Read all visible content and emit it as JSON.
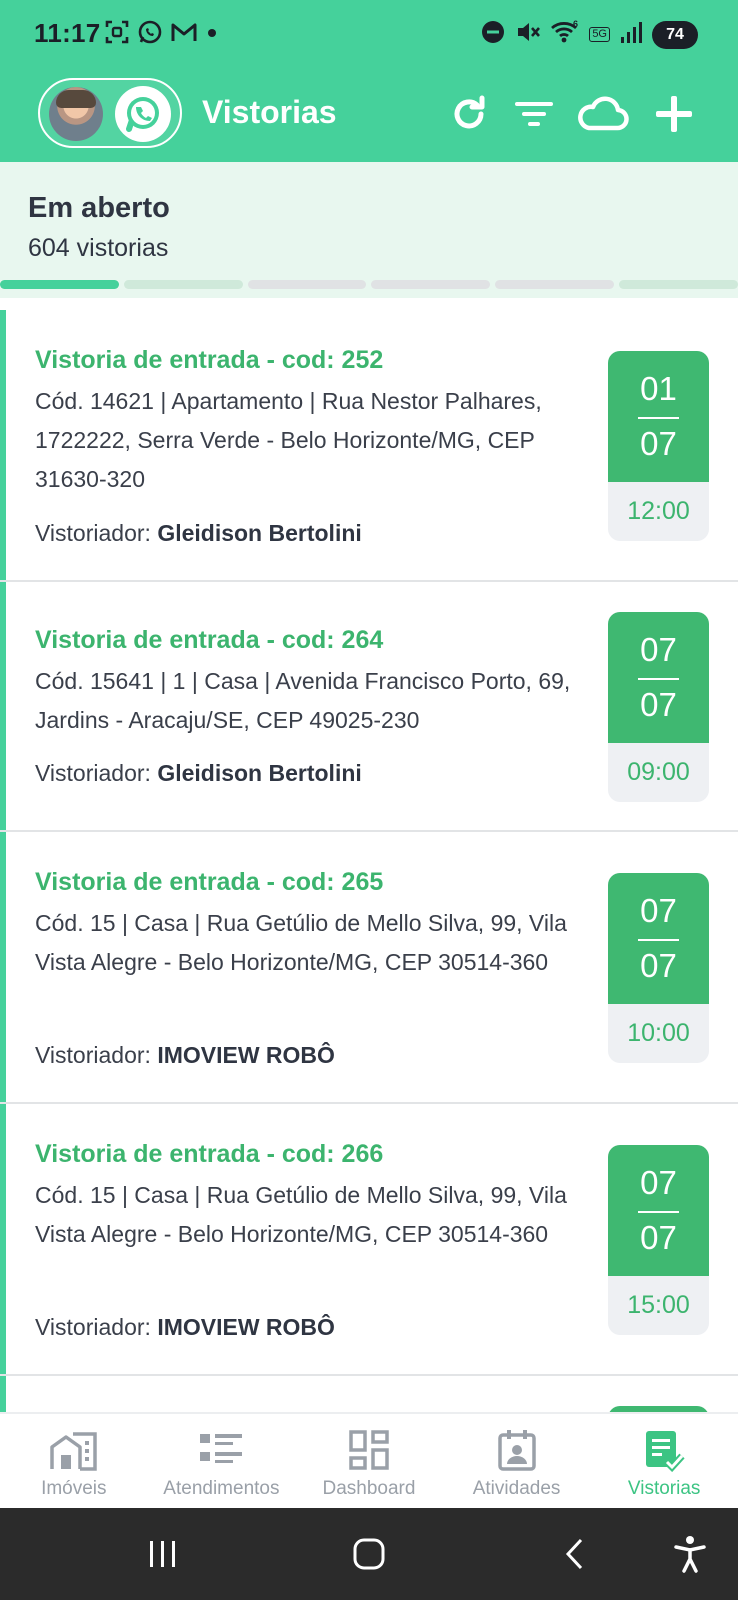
{
  "status_bar": {
    "time": "11:17",
    "battery": "74",
    "network": "5G"
  },
  "app_bar": {
    "title": "Vistorias",
    "actions": [
      "refresh-icon",
      "filter-icon",
      "cloud-icon",
      "add-icon"
    ]
  },
  "section": {
    "title": "Em aberto",
    "count": "604 vistorias",
    "tabs_total": 6,
    "active_tab": 0
  },
  "inspections": [
    {
      "title": "Vistoria de entrada - cod: 252",
      "address": "Cód. 14621 | Apartamento | Rua Nestor Palhares, 1722222, Serra Verde - Belo Horizonte/MG, CEP 31630-320",
      "inspector_label": "Vistoriador: ",
      "inspector": "Gleidison Bertolini",
      "day": "01",
      "month": "07",
      "time": "12:00"
    },
    {
      "title": "Vistoria de entrada - cod: 264",
      "address": "Cód. 15641 | 1 | Casa | Avenida Francisco Porto, 69, Jardins - Aracaju/SE, CEP 49025-230",
      "inspector_label": "Vistoriador: ",
      "inspector": "Gleidison Bertolini",
      "day": "07",
      "month": "07",
      "time": "09:00"
    },
    {
      "title": "Vistoria de entrada - cod: 265",
      "address": "Cód. 15 | Casa | Rua Getúlio de Mello Silva, 99, Vila Vista Alegre - Belo Horizonte/MG, CEP 30514-360",
      "inspector_label": "Vistoriador: ",
      "inspector": "IMOVIEW ROBÔ",
      "day": "07",
      "month": "07",
      "time": "10:00"
    },
    {
      "title": "Vistoria de entrada - cod: 266",
      "address": "Cód. 15 | Casa | Rua Getúlio de Mello Silva, 99, Vila Vista Alegre - Belo Horizonte/MG, CEP 30514-360",
      "inspector_label": "Vistoriador: ",
      "inspector": "IMOVIEW ROBÔ",
      "day": "07",
      "month": "07",
      "time": "15:00"
    }
  ],
  "bottom_nav": {
    "items": [
      {
        "label": "Imóveis",
        "icon": "buildings-icon"
      },
      {
        "label": "Atendimentos",
        "icon": "list-icon"
      },
      {
        "label": "Dashboard",
        "icon": "dashboard-icon"
      },
      {
        "label": "Atividades",
        "icon": "calendar-icon"
      },
      {
        "label": "Vistorias",
        "icon": "clipboard-check-icon"
      }
    ],
    "active": "Vistorias"
  },
  "colors": {
    "primary": "#45d19b",
    "accent_green": "#3cb46e",
    "badge_green": "#3fb871",
    "section_bg": "#e8f7ef",
    "text": "#2f3542",
    "nav_inactive": "#9aa0a8"
  }
}
